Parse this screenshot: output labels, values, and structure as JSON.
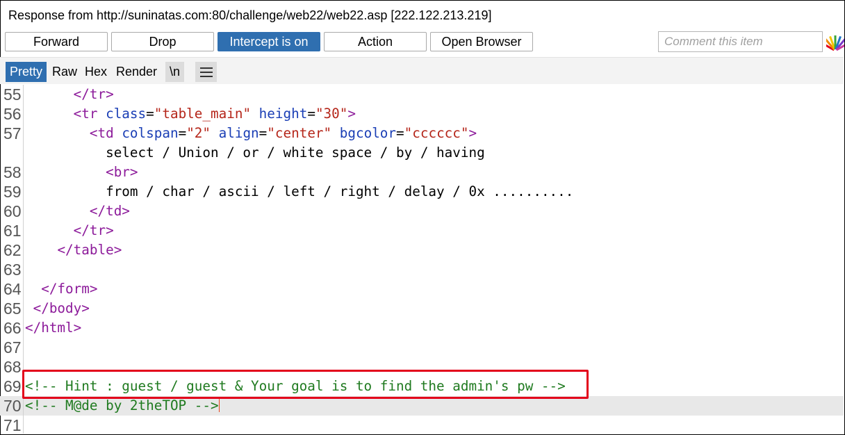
{
  "window": {
    "title": "Response from http://suninatas.com:80/challenge/web22/web22.asp   [222.122.213.219]"
  },
  "toolbar": {
    "forward_label": "Forward",
    "drop_label": "Drop",
    "intercept_label": "Intercept is on",
    "action_label": "Action",
    "open_browser_label": "Open Browser",
    "comment_placeholder": "Comment this item",
    "highlight_icon": "highlighter-palette-icon"
  },
  "tabs": {
    "pretty": "Pretty",
    "raw": "Raw",
    "hex": "Hex",
    "render": "Render",
    "newline": "\\n",
    "menu_icon": "hamburger-menu-icon"
  },
  "code": {
    "lines": [
      {
        "n": "55",
        "indent": "      ",
        "tokens": [
          [
            "tag",
            "</tr>"
          ]
        ]
      },
      {
        "n": "56",
        "indent": "      ",
        "tokens": [
          [
            "tag",
            "<tr "
          ],
          [
            "attr",
            "class"
          ],
          [
            "plain",
            "="
          ],
          [
            "val",
            "\"table_main\""
          ],
          [
            "plain",
            " "
          ],
          [
            "attr",
            "height"
          ],
          [
            "plain",
            "="
          ],
          [
            "val",
            "\"30\""
          ],
          [
            "tag",
            ">"
          ]
        ]
      },
      {
        "n": "57",
        "indent": "        ",
        "tokens": [
          [
            "tag",
            "<td "
          ],
          [
            "attr",
            "colspan"
          ],
          [
            "plain",
            "="
          ],
          [
            "val",
            "\"2\""
          ],
          [
            "plain",
            " "
          ],
          [
            "attr",
            "align"
          ],
          [
            "plain",
            "="
          ],
          [
            "val",
            "\"center\""
          ],
          [
            "plain",
            " "
          ],
          [
            "attr",
            "bgcolor"
          ],
          [
            "plain",
            "="
          ],
          [
            "val",
            "\"cccccc\""
          ],
          [
            "tag",
            ">"
          ]
        ]
      },
      {
        "n": "",
        "indent": "          ",
        "tokens": [
          [
            "plain",
            "select / Union / or / white space / by / having"
          ]
        ]
      },
      {
        "n": "58",
        "indent": "          ",
        "tokens": [
          [
            "tag",
            "<br>"
          ]
        ]
      },
      {
        "n": "59",
        "indent": "          ",
        "tokens": [
          [
            "plain",
            "from / char / ascii / left / right / delay / 0x .........."
          ]
        ]
      },
      {
        "n": "60",
        "indent": "        ",
        "tokens": [
          [
            "tag",
            "</td>"
          ]
        ]
      },
      {
        "n": "61",
        "indent": "      ",
        "tokens": [
          [
            "tag",
            "</tr>"
          ]
        ]
      },
      {
        "n": "62",
        "indent": "    ",
        "tokens": [
          [
            "tag",
            "</table>"
          ]
        ]
      },
      {
        "n": "63",
        "indent": "",
        "tokens": []
      },
      {
        "n": "64",
        "indent": "  ",
        "tokens": [
          [
            "tag",
            "</form>"
          ]
        ]
      },
      {
        "n": "65",
        "indent": " ",
        "tokens": [
          [
            "tag",
            "</body>"
          ]
        ]
      },
      {
        "n": "66",
        "indent": "",
        "tokens": [
          [
            "tag",
            "</html>"
          ]
        ]
      },
      {
        "n": "67",
        "indent": "",
        "tokens": []
      },
      {
        "n": "68",
        "indent": "",
        "tokens": []
      },
      {
        "n": "69",
        "indent": "",
        "tokens": [
          [
            "com",
            "<!-- Hint : guest / guest & Your goal is to find the admin's pw -->"
          ]
        ]
      },
      {
        "n": "70",
        "indent": "",
        "tokens": [
          [
            "com",
            "<!-- M@de by 2theTOP -->"
          ]
        ],
        "current": true
      },
      {
        "n": "71",
        "indent": "",
        "tokens": []
      }
    ]
  },
  "colors": {
    "accent": "#2f6fb0",
    "tag": "#8c1a9a",
    "attribute": "#1a3eb5",
    "value": "#b5261a",
    "comment": "#1f7a1f",
    "annotation_box": "#e3001b"
  }
}
